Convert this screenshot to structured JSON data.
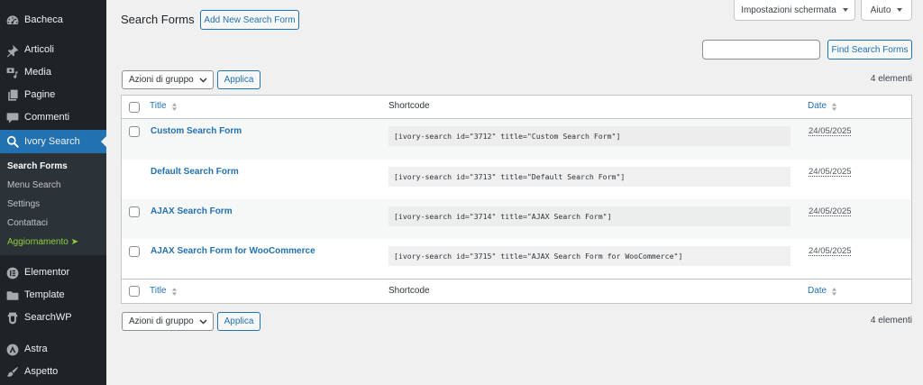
{
  "colors": {
    "accent": "#2271b1",
    "sidebar_bg": "#1d2327",
    "submenu_bg": "#2c3338",
    "content_bg": "#f0f0f1",
    "upgrade_link": "#8fcf3c"
  },
  "sidebar": {
    "items": [
      {
        "label": "Bacheca",
        "icon": "dashboard-icon"
      },
      {
        "label": "Articoli",
        "icon": "pin-icon"
      },
      {
        "label": "Media",
        "icon": "media-icon"
      },
      {
        "label": "Pagine",
        "icon": "pages-icon"
      },
      {
        "label": "Commenti",
        "icon": "comments-icon"
      },
      {
        "label": "Ivory Search",
        "icon": "search-icon",
        "active": true
      },
      {
        "label": "Elementor",
        "icon": "elementor-icon"
      },
      {
        "label": "Template",
        "icon": "folder-icon"
      },
      {
        "label": "SearchWP",
        "icon": "searchwp-icon"
      },
      {
        "label": "Astra",
        "icon": "astra-icon"
      },
      {
        "label": "Aspetto",
        "icon": "brush-icon"
      }
    ],
    "submenu": [
      {
        "label": "Search Forms",
        "current": true
      },
      {
        "label": "Menu Search"
      },
      {
        "label": "Settings"
      },
      {
        "label": "Contattaci"
      },
      {
        "label": "Aggiornamento ➤"
      }
    ]
  },
  "screen_meta": {
    "screen_options": "Impostazioni schermata",
    "help": "Aiuto"
  },
  "page": {
    "title": "Search Forms",
    "add_new_button": "Add New Search Form"
  },
  "search": {
    "button": "Find Search Forms"
  },
  "bulk_actions_top": {
    "selected": "Azioni di gruppo",
    "apply": "Applica",
    "count": "4 elementi"
  },
  "bulk_actions_bottom": {
    "selected": "Azioni di gruppo",
    "apply": "Applica",
    "count": "4 elementi"
  },
  "table": {
    "columns": {
      "title": "Title",
      "shortcode": "Shortcode",
      "date": "Date"
    },
    "rows": [
      {
        "title": "Custom Search Form",
        "shortcode": "[ivory-search id=\"3712\" title=\"Custom Search Form\"]",
        "date": "24/05/2025",
        "has_checkbox": true
      },
      {
        "title": "Default Search Form",
        "shortcode": "[ivory-search id=\"3713\" title=\"Default Search Form\"]",
        "date": "24/05/2025",
        "has_checkbox": false
      },
      {
        "title": "AJAX Search Form",
        "shortcode": "[ivory-search id=\"3714\" title=\"AJAX Search Form\"]",
        "date": "24/05/2025",
        "has_checkbox": true
      },
      {
        "title": "AJAX Search Form for WooCommerce",
        "shortcode": "[ivory-search id=\"3715\" title=\"AJAX Search Form for WooCommerce\"]",
        "date": "24/05/2025",
        "has_checkbox": true
      }
    ]
  }
}
